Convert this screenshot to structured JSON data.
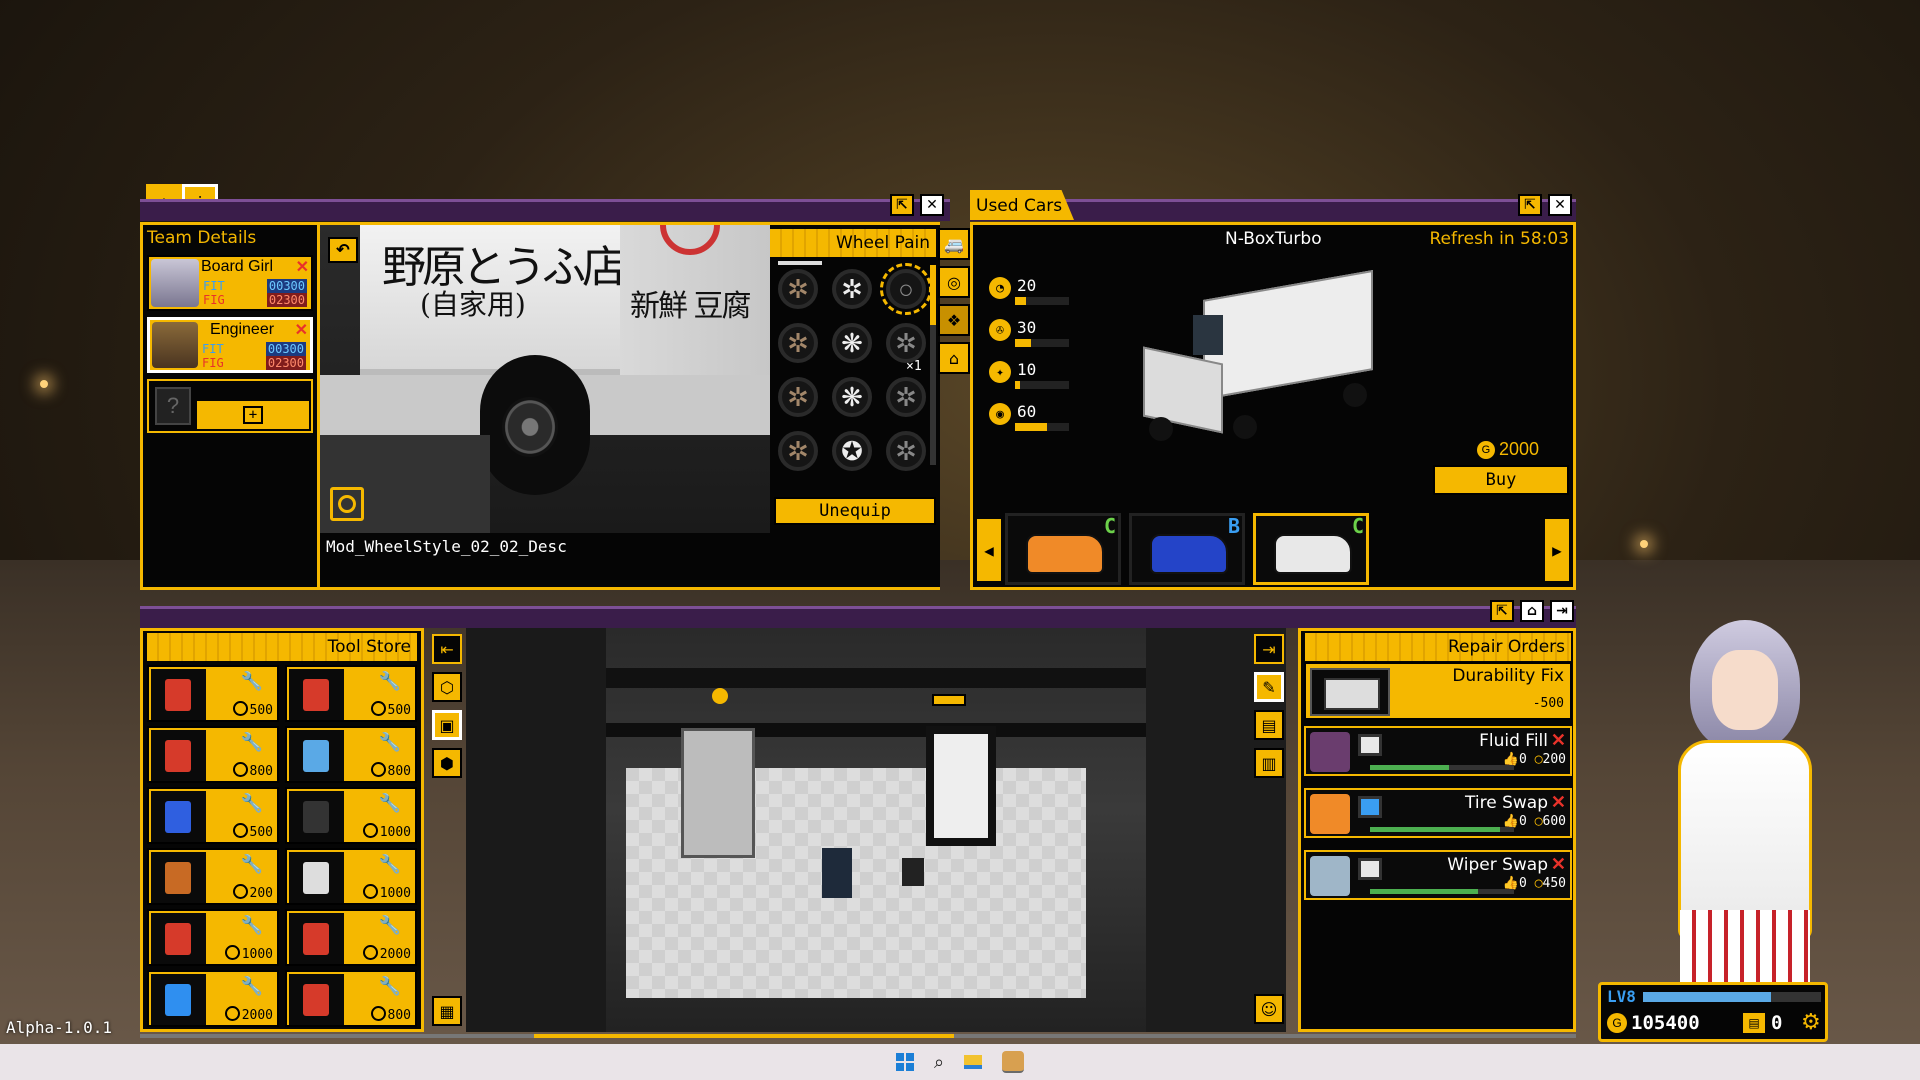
{
  "game": {
    "version": "Alpha-1.0.1"
  },
  "team_panel": {
    "header": "Team Details",
    "members": [
      {
        "role": "Board Girl",
        "fit_label": "FIT",
        "fit_value": "00300",
        "fig_label": "FIG",
        "fig_value": "02300"
      },
      {
        "role": "Engineer",
        "fit_label": "FIT",
        "fit_value": "00300",
        "fig_label": "FIG",
        "fig_value": "02300"
      }
    ],
    "empty_slot": "?",
    "add": "+"
  },
  "preview": {
    "sign_line1": "野原とうふ店",
    "sign_line2": "(自家用)",
    "side_text": "新鮮 豆腐",
    "description": "Mod_WheelStyle_02_02_Desc",
    "back_icon": "back-arrow-icon",
    "focus_icon": "focus-target-icon"
  },
  "wheel_paint": {
    "header": "Wheel Pain",
    "count": "×1",
    "unequip_label": "Unequip",
    "wheels": [
      "✲",
      "✲",
      "○",
      "✲",
      "❋",
      "✲",
      "✲",
      "❋",
      "✲",
      "✲",
      "✪",
      "✲"
    ]
  },
  "used_cars": {
    "tab": "Used Cars",
    "car_name": "N-BoxTurbo",
    "refresh": "Refresh in 58:03",
    "stats": [
      {
        "icon": "speedometer-icon",
        "value": "20",
        "fill": 0.2
      },
      {
        "icon": "steering-wheel-icon",
        "value": "30",
        "fill": 0.3
      },
      {
        "icon": "acceleration-icon",
        "value": "10",
        "fill": 0.1
      },
      {
        "icon": "fuel-drop-icon",
        "value": "60",
        "fill": 0.6
      }
    ],
    "price": "2000",
    "buy_label": "Buy",
    "cars": [
      {
        "grade": "C",
        "color": "#f08a28",
        "grade_color": "#6cd14a"
      },
      {
        "grade": "B",
        "color": "#2444c8",
        "grade_color": "#3a9ef2"
      },
      {
        "grade": "C",
        "color": "#e8e8e8",
        "grade_color": "#6cd14a"
      }
    ]
  },
  "tool_store": {
    "header": "Tool Store",
    "tools": [
      {
        "icon": "creeper-icon",
        "price": "500",
        "color": "#d63a2a"
      },
      {
        "icon": "creeper-icon",
        "price": "500",
        "color": "#d63a2a"
      },
      {
        "icon": "fluid-bottle-icon",
        "price": "800",
        "color": "#d63a2a"
      },
      {
        "icon": "fluid-bottle-icon",
        "price": "800",
        "color": "#5aa9e6"
      },
      {
        "icon": "toolbox-icon",
        "price": "500",
        "color": "#2f5fe0"
      },
      {
        "icon": "ramp-icon",
        "price": "1000",
        "color": "#333333"
      },
      {
        "icon": "engine-icon",
        "price": "200",
        "color": "#c86a24"
      },
      {
        "icon": "tire-changer-icon",
        "price": "1000",
        "color": "#dddddd"
      },
      {
        "icon": "diagnostic-machine-icon",
        "price": "1000",
        "color": "#d63a2a"
      },
      {
        "icon": "car-lift-icon",
        "price": "2000",
        "color": "#d63a2a"
      },
      {
        "icon": "car-lift-icon",
        "price": "2000",
        "color": "#2f8ff0"
      },
      {
        "icon": "jack-stand-icon",
        "price": "800",
        "color": "#d63a2a"
      }
    ]
  },
  "repair_orders": {
    "header": "Repair Orders",
    "durability": {
      "label": "Durability Fix",
      "value": "-500"
    },
    "orders": [
      {
        "label": "Fluid Fill",
        "likes": "0",
        "reward": "200",
        "progress": 0.55,
        "avatar": "#6a3d6e",
        "sq_color": "#e8e8e8"
      },
      {
        "label": "Tire Swap",
        "likes": "0",
        "reward": "600",
        "progress": 0.9,
        "avatar": "#f08a28",
        "sq_color": "#3a9ef2"
      },
      {
        "label": "Wiper Swap",
        "likes": "0",
        "reward": "450",
        "progress": 0.75,
        "avatar": "#9fb6c8",
        "sq_color": "#e8e8e8"
      }
    ]
  },
  "player": {
    "level_label": "LV8",
    "level_progress": 0.72,
    "coins": "105400",
    "tickets": "0",
    "settings_icon": "gear-icon"
  },
  "taskbar": {
    "icons": [
      "windows-start-icon",
      "search-icon",
      "file-explorer-icon",
      "game-app-icon"
    ]
  }
}
